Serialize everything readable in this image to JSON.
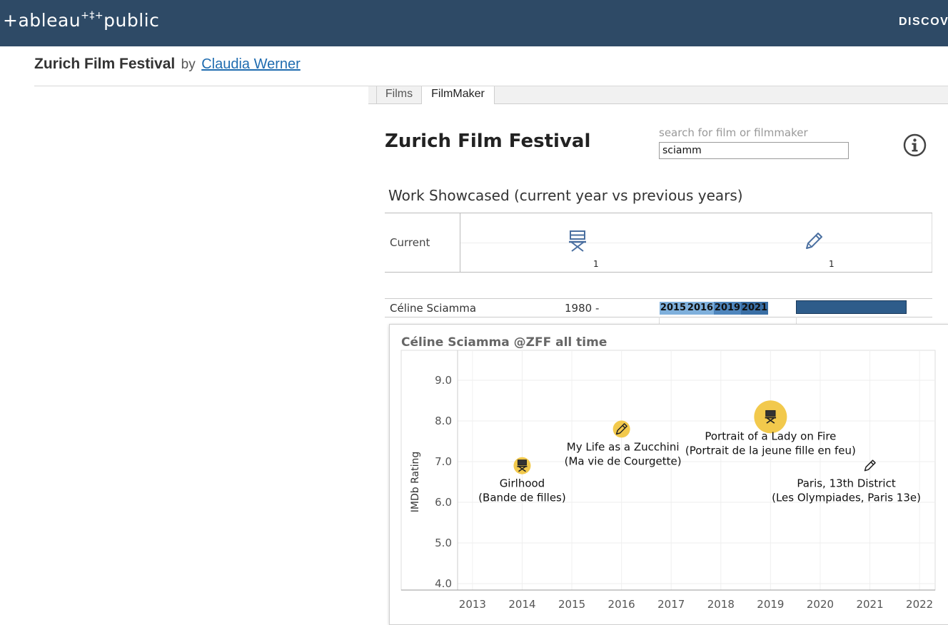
{
  "header": {
    "logo_left": "+ableau",
    "logo_sparkle": "+‡+",
    "logo_right": "public",
    "nav_discover": "DISCOV"
  },
  "viz": {
    "title": "Zurich Film Festival",
    "by_label": "by",
    "author": "Claudia Werner"
  },
  "tabs": [
    {
      "label": "Films",
      "active": false
    },
    {
      "label": "FilmMaker",
      "active": true
    }
  ],
  "dashboard": {
    "title": "Zurich Film Festival",
    "search": {
      "label": "search for film or filmmaker",
      "value": "sciamm"
    },
    "info_icon": "info-icon"
  },
  "showcase": {
    "title": "Work Showcased (current year vs previous years)",
    "row_label": "Current",
    "items": [
      {
        "role": "director",
        "icon": "director-chair-icon",
        "count": "1"
      },
      {
        "role": "writer",
        "icon": "pencil-icon",
        "count": "1"
      }
    ]
  },
  "filmmaker_row": {
    "name": "Céline Sciamma",
    "born": "1980 -",
    "years": [
      "2015",
      "2016",
      "2019",
      "2021"
    ]
  },
  "colors": {
    "topbar": "#2e4a66",
    "chip_light": "#7fb0dc",
    "chip_dark": "#2e5c8a",
    "bubble": "#f2c94c",
    "link": "#1f6cb0"
  },
  "tooltip": {
    "title": "Céline Sciamma @ZFF all time"
  },
  "chart_data": {
    "type": "scatter",
    "title": "Céline Sciamma @ZFF all time",
    "ylabel": "IMDb Rating",
    "xlabel": "",
    "xlim": [
      2013,
      2022
    ],
    "ylim": [
      4.0,
      9.0
    ],
    "x_ticks": [
      2013,
      2014,
      2015,
      2016,
      2017,
      2018,
      2019,
      2020,
      2021,
      2022
    ],
    "y_ticks": [
      "4.0",
      "5.0",
      "6.0",
      "7.0",
      "8.0",
      "9.0"
    ],
    "grid": true,
    "points": [
      {
        "x": 2014,
        "y": 6.9,
        "role": "director",
        "size": "small",
        "label1": "Girlhood",
        "label2": "(Bande de filles)"
      },
      {
        "x": 2016,
        "y": 7.8,
        "role": "writer",
        "size": "small",
        "label1": "My Life as a Zucchini",
        "label2": "(Ma vie de Courgette)"
      },
      {
        "x": 2019,
        "y": 8.1,
        "role": "director",
        "size": "large",
        "label1": "Portrait of a Lady on Fire",
        "label2": "(Portrait de la jeune fille en feu)"
      },
      {
        "x": 2021,
        "y": 6.9,
        "role": "writer",
        "size": "none",
        "label1": "Paris, 13th District",
        "label2": "(Les Olympiades, Paris 13e)"
      }
    ]
  }
}
